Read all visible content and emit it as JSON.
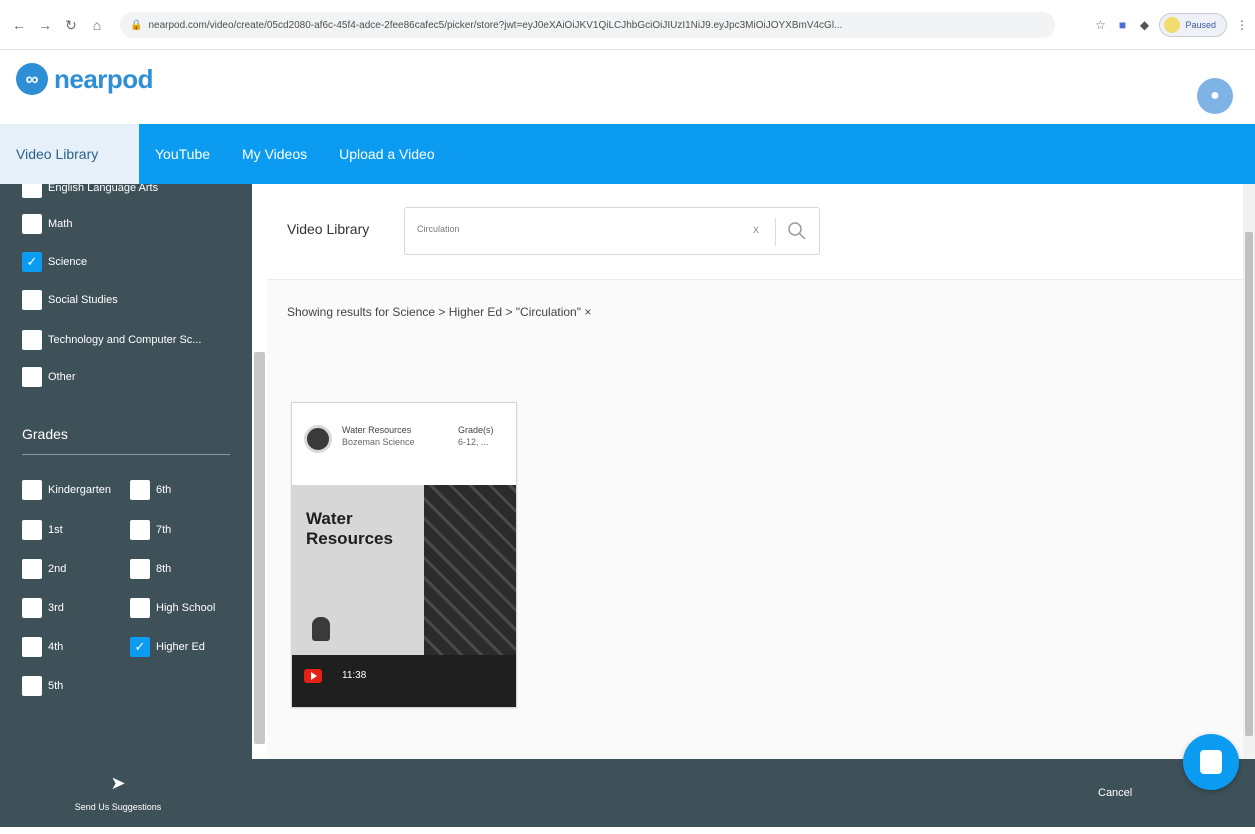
{
  "browser": {
    "url": "nearpod.com/video/create/05cd2080-af6c-45f4-adce-2fee86cafec5/picker/store?jwt=eyJ0eXAiOiJKV1QiLCJhbGciOiJIUzI1NiJ9.eyJpc3MiOiJOYXBmV4cGl...",
    "extension_label": "Paused",
    "colors": {
      "accent": "#0b9cf2"
    }
  },
  "header": {
    "logo_text": "nearpod"
  },
  "tabs": [
    {
      "label": "Video Library",
      "active": true
    },
    {
      "label": "YouTube",
      "active": false
    },
    {
      "label": "My Videos",
      "active": false
    },
    {
      "label": "Upload a Video",
      "active": false
    }
  ],
  "sidebar": {
    "subjects": [
      {
        "label": "English Language Arts",
        "checked": false
      },
      {
        "label": "Math",
        "checked": false
      },
      {
        "label": "Science",
        "checked": true
      },
      {
        "label": "Social Studies",
        "checked": false
      },
      {
        "label": "Technology and Computer Sc...",
        "checked": false
      },
      {
        "label": "Other",
        "checked": false
      }
    ],
    "grades_title": "Grades",
    "grades_left": [
      {
        "label": "Kindergarten",
        "checked": false
      },
      {
        "label": "1st",
        "checked": false
      },
      {
        "label": "2nd",
        "checked": false
      },
      {
        "label": "3rd",
        "checked": false
      },
      {
        "label": "4th",
        "checked": false
      },
      {
        "label": "5th",
        "checked": false
      }
    ],
    "grades_right": [
      {
        "label": "6th",
        "checked": false
      },
      {
        "label": "7th",
        "checked": false
      },
      {
        "label": "8th",
        "checked": false
      },
      {
        "label": "High School",
        "checked": false
      },
      {
        "label": "Higher Ed",
        "checked": true
      }
    ]
  },
  "main": {
    "library_label": "Video Library",
    "search_value": "Circulation",
    "clear_symbol": "x",
    "results_text": "Showing results for Science > Higher Ed > \"Circulation\" ×"
  },
  "card": {
    "title": "Water Resources",
    "author": "Bozeman Science",
    "grade_label": "Grade(s)",
    "grade_value": "6-12, ...",
    "thumb_title_line1": "Water",
    "thumb_title_line2": "Resources",
    "duration": "11:38"
  },
  "footer": {
    "suggestions_label": "Send Us Suggestions",
    "cancel_label": "Cancel"
  }
}
